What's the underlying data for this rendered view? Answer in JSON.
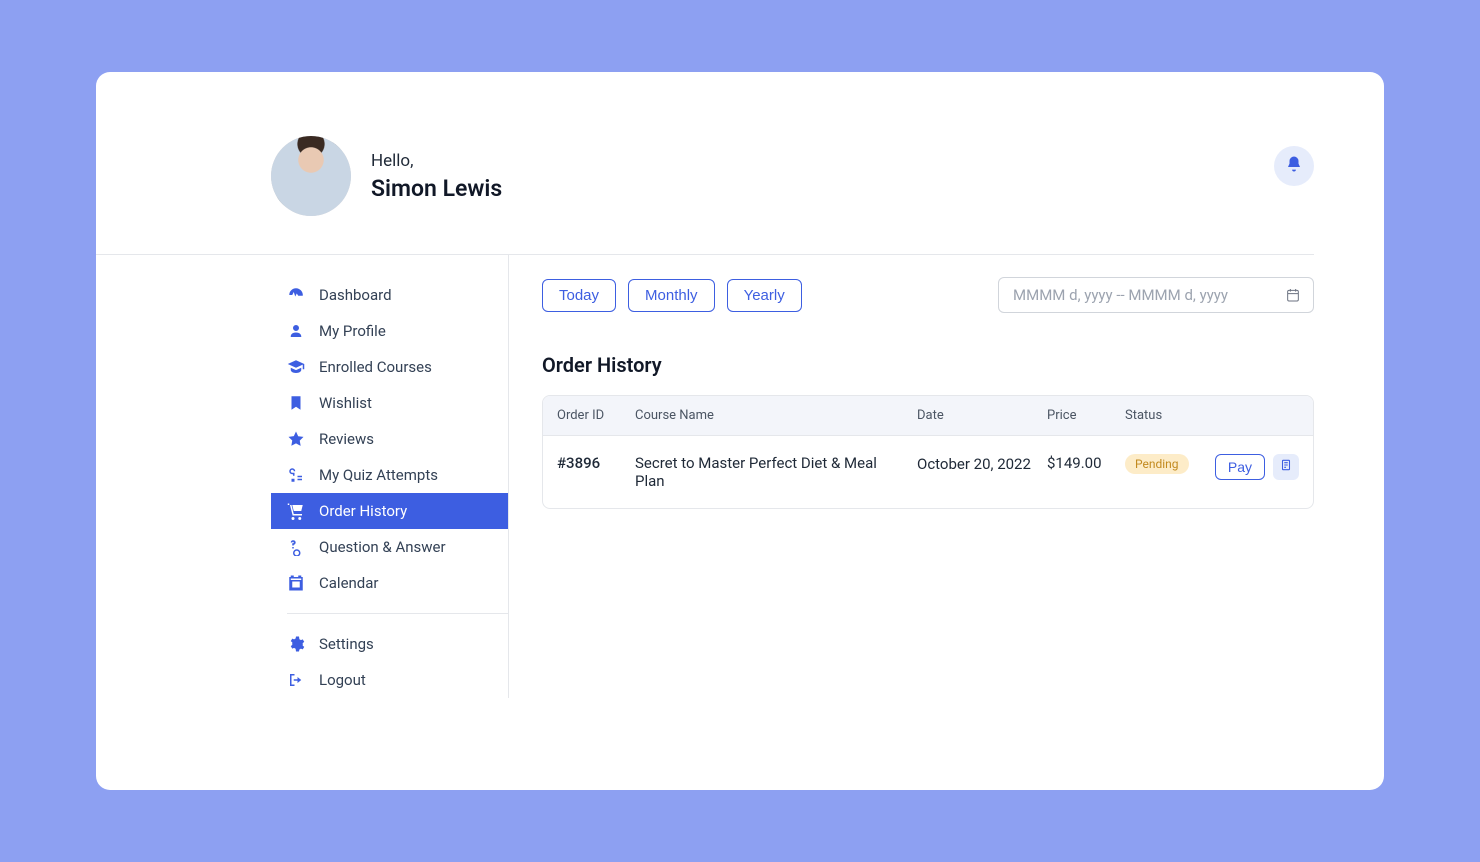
{
  "header": {
    "greeting": "Hello,",
    "name": "Simon Lewis"
  },
  "sidebar": {
    "items": [
      {
        "label": "Dashboard",
        "icon": "dashboard"
      },
      {
        "label": "My Profile",
        "icon": "user"
      },
      {
        "label": "Enrolled Courses",
        "icon": "graduation"
      },
      {
        "label": "Wishlist",
        "icon": "bookmark"
      },
      {
        "label": "Reviews",
        "icon": "star"
      },
      {
        "label": "My Quiz Attempts",
        "icon": "quiz"
      },
      {
        "label": "Order History",
        "icon": "cart",
        "active": true
      },
      {
        "label": "Question & Answer",
        "icon": "qa"
      },
      {
        "label": "Calendar",
        "icon": "calendar"
      }
    ],
    "footer_items": [
      {
        "label": "Settings",
        "icon": "gear"
      },
      {
        "label": "Logout",
        "icon": "logout"
      }
    ]
  },
  "filters": {
    "today": "Today",
    "monthly": "Monthly",
    "yearly": "Yearly",
    "date_placeholder": "MMMM d, yyyy -- MMMM d, yyyy"
  },
  "page": {
    "title": "Order History"
  },
  "table": {
    "headers": {
      "id": "Order ID",
      "name": "Course Name",
      "date": "Date",
      "price": "Price",
      "status": "Status"
    },
    "rows": [
      {
        "id": "#3896",
        "name": "Secret to Master Perfect Diet & Meal Plan",
        "date": "October 20, 2022",
        "price": "$149.00",
        "status": "Pending",
        "action": "Pay"
      }
    ]
  }
}
